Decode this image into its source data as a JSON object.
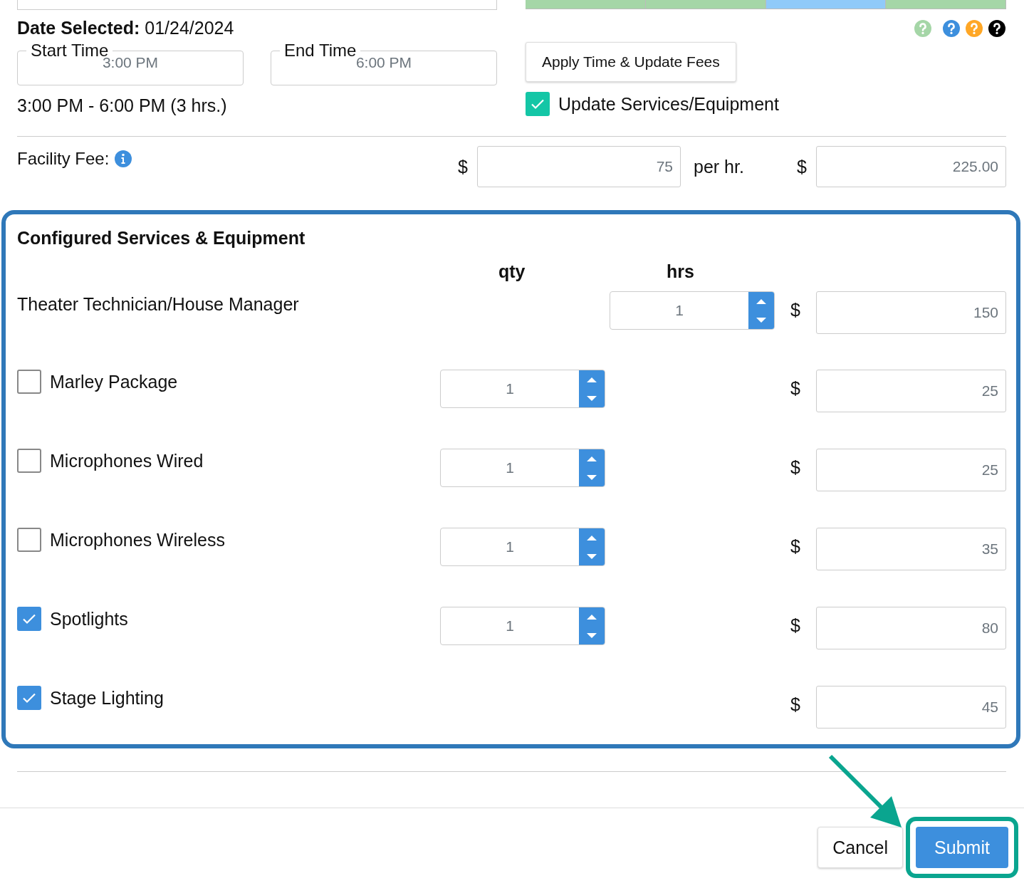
{
  "timeline": [
    {
      "color": "#a5d6a7"
    },
    {
      "color": "#a5d6a7"
    },
    {
      "color": "#90caf9"
    },
    {
      "color": "#a5d6a7"
    }
  ],
  "help_icons": [
    {
      "color": "#a5d6a7"
    },
    {
      "color": "#3d8fdd"
    },
    {
      "color": "#ffa726"
    },
    {
      "color": "#000000"
    }
  ],
  "date_selected": {
    "label": "Date Selected:",
    "value": "01/24/2024"
  },
  "start_time": {
    "label": "Start Time",
    "value": "3:00 PM"
  },
  "end_time": {
    "label": "End Time",
    "value": "6:00 PM"
  },
  "apply_button": "Apply Time & Update Fees",
  "time_range": "3:00 PM - 6:00 PM (3 hrs.)",
  "update_services": {
    "label": "Update Services/Equipment",
    "checked": true
  },
  "facility_fee": {
    "label": "Facility Fee:",
    "currency": "$",
    "rate": "75",
    "rate_unit": "per hr.",
    "total_currency": "$",
    "total": "225.00"
  },
  "services": {
    "title": "Configured Services & Equipment",
    "qty_header": "qty",
    "hrs_header": "hrs",
    "items": [
      {
        "kind": "hours",
        "name": "Theater Technician/House Manager",
        "hrs": "1",
        "currency": "$",
        "price": "150"
      },
      {
        "kind": "quantity",
        "name": "Marley Package",
        "checked": false,
        "qty": "1",
        "currency": "$",
        "price": "25"
      },
      {
        "kind": "quantity",
        "name": "Microphones Wired",
        "checked": false,
        "qty": "1",
        "currency": "$",
        "price": "25"
      },
      {
        "kind": "quantity",
        "name": "Microphones Wireless",
        "checked": false,
        "qty": "1",
        "currency": "$",
        "price": "35"
      },
      {
        "kind": "quantity",
        "name": "Spotlights",
        "checked": true,
        "qty": "1",
        "currency": "$",
        "price": "80"
      },
      {
        "kind": "fixed",
        "name": "Stage Lighting",
        "checked": true,
        "currency": "$",
        "price": "45"
      }
    ]
  },
  "buttons": [
    {
      "label": "Cancel",
      "kind": "secondary"
    },
    {
      "label": "Submit",
      "kind": "primary"
    }
  ]
}
